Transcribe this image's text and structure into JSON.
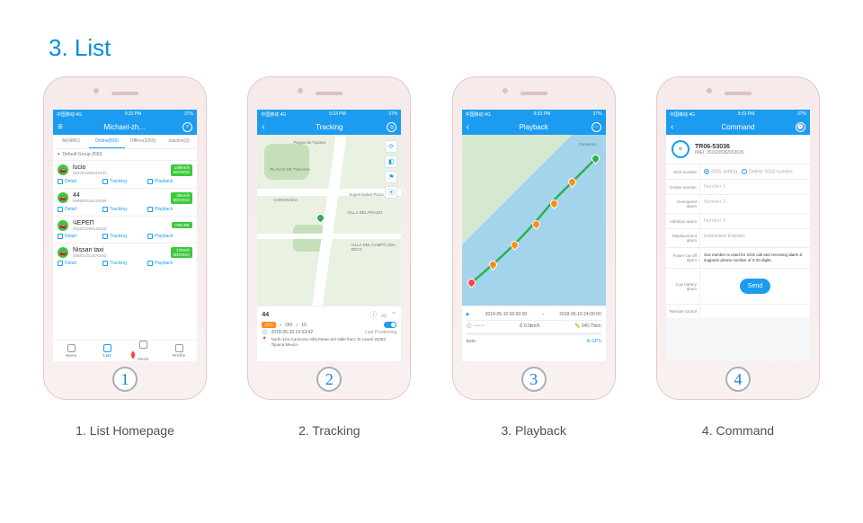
{
  "page_title": "3. List",
  "captions": [
    "1. List Homepage",
    "2. Tracking",
    "3. Playback",
    "4. Command"
  ],
  "home_numbers": [
    "1",
    "2",
    "3",
    "4"
  ],
  "status": {
    "left": "中国移动 4G",
    "time": "9:33 PM",
    "right": "37%"
  },
  "screen1": {
    "title": "Michael-zh…",
    "tabs": [
      "All(4881)",
      "Online(830)",
      "Offline(2055)",
      "Inactive(3)"
    ],
    "group": "Default Group  (830)",
    "devices": [
      {
        "name": "lucio",
        "imei": "353701090042331",
        "badge": "108km/h",
        "status": "MOVING",
        "color": "#3cc93c"
      },
      {
        "name": "44",
        "imei": "868593018149489",
        "badge": "39km/h",
        "status": "MOVING",
        "color": "#3cc93c"
      },
      {
        "name": "ЧЕРЕП",
        "imei": "353201089128136",
        "badge": "ONLINE",
        "status": "",
        "color": "#3cc93c"
      },
      {
        "name": "Nissan taxi",
        "imei": "358831011870482",
        "badge": "17km/h",
        "status": "MOVING",
        "color": "#3cc93c"
      }
    ],
    "actions": [
      "Detail",
      "Tracking",
      "Playback"
    ],
    "nav": [
      "Home",
      "List",
      "Alerts",
      "Profile"
    ]
  },
  "screen2": {
    "title": "Tracking",
    "map_labels": [
      "Playas de Tijuana",
      "PLAYAS DE TIJUANA",
      "CORONADO",
      "VILLA DEL PRADO",
      "Supermarket Plaza",
      "VILLA DEL CAMPO 2DA. SECC"
    ],
    "panel": {
      "name": "44",
      "acc": "ACC",
      "on": "ON",
      "speed": "10",
      "time": "2018-05-10  19:53:42",
      "last": "Last Positioning",
      "addr": "North 11m,Carnicera Villa,Paseo del Valle fracc XI Laurel 22253 Tijuana Mexico"
    }
  },
  "screen3": {
    "title": "Playback",
    "map_labels": [
      "Campinas"
    ],
    "panel": {
      "date_from": "2018-05-10 00:00:00",
      "date_to": "2018-05-10 24:00:00",
      "speed": "0.0km/h",
      "dist": "345.75km",
      "name": "lucio",
      "gps": "GPS"
    }
  },
  "screen4": {
    "title": "Command",
    "device": "TR06-53036",
    "imei_lbl": "IMEI:",
    "imei": "351608082653036",
    "rows": [
      {
        "lbl": "SOS number",
        "type": "radio",
        "opts": [
          "SOS setting",
          "Delete SOS number"
        ]
      },
      {
        "lbl": "Center number",
        "type": "input",
        "ph": "Number 1"
      },
      {
        "lbl": "Overspeed alarm",
        "type": "input",
        "ph": "Number 2"
      },
      {
        "lbl": "Vibration alarm",
        "type": "input",
        "ph": "Number 3"
      },
      {
        "lbl": "Displacement alarm",
        "type": "text",
        "val": "Instruction Explain:"
      },
      {
        "lbl": "Power cut-off alarm",
        "type": "note",
        "val": "Sos number is used for SOS call and receiving alarm.It supports phone number of 3-20 digits."
      },
      {
        "lbl": "Low battery alarm",
        "type": "button",
        "val": "Send"
      },
      {
        "lbl": "Remote control",
        "type": "blank",
        "val": ""
      }
    ]
  }
}
